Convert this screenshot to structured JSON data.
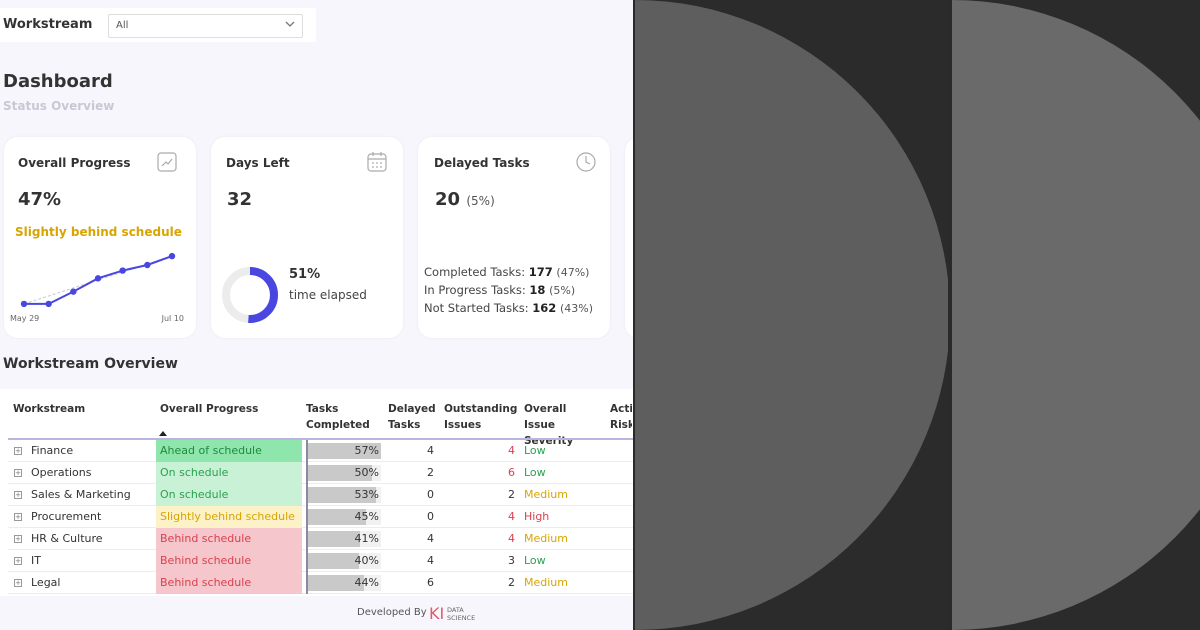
{
  "filter": {
    "label": "Workstream",
    "value": "All"
  },
  "header": {
    "title": "Dashboard",
    "subtitle": "Status Overview"
  },
  "cards": {
    "progress": {
      "title": "Overall Progress",
      "value": "47%",
      "status": "Slightly behind schedule",
      "start_label": "May 29",
      "end_label": "Jul 10",
      "icon": "trend-icon"
    },
    "days_left": {
      "title": "Days Left",
      "value": "32",
      "elapsed_pct": "51%",
      "elapsed_label": "time elapsed",
      "elapsed_fraction": 0.51,
      "icon": "calendar-icon"
    },
    "delayed": {
      "title": "Delayed Tasks",
      "value": "20",
      "value_pct": "(5%)",
      "icon": "clock-icon",
      "lines": [
        {
          "label": "Completed Tasks:",
          "count": "177",
          "pct": "(47%)"
        },
        {
          "label": "In Progress Tasks:",
          "count": "18",
          "pct": "(5%)"
        },
        {
          "label": "Not Started Tasks:",
          "count": "162",
          "pct": "(43%)"
        }
      ]
    }
  },
  "chart_data": {
    "type": "line",
    "x": [
      "May 29",
      "",
      "",
      "",
      "",
      "",
      "Jul 10"
    ],
    "series": [
      {
        "values": [
          1,
          1,
          12,
          24,
          31,
          36,
          44
        ]
      }
    ],
    "trend": [
      1,
      44
    ]
  },
  "table": {
    "title": "Workstream Overview",
    "headers": [
      "Workstream",
      "Overall Progress",
      "Tasks Completed",
      "Delayed Tasks",
      "Outstanding Issues",
      "Overall Issue Severity",
      "Acti Risk"
    ],
    "rows": [
      {
        "name": "Finance",
        "status": "Ahead of schedule",
        "completed": "57%",
        "completed_value": 0.57,
        "delayed": "4",
        "issues": "4",
        "severity": "Low"
      },
      {
        "name": "Operations",
        "status": "On schedule",
        "completed": "50%",
        "completed_value": 0.5,
        "delayed": "2",
        "issues": "6",
        "severity": "Low"
      },
      {
        "name": "Sales & Marketing",
        "status": "On schedule",
        "completed": "53%",
        "completed_value": 0.53,
        "delayed": "0",
        "issues": "2",
        "severity": "Medium"
      },
      {
        "name": "Procurement",
        "status": "Slightly behind schedule",
        "completed": "45%",
        "completed_value": 0.45,
        "delayed": "0",
        "issues": "4",
        "severity": "High"
      },
      {
        "name": "HR & Culture",
        "status": "Behind schedule",
        "completed": "41%",
        "completed_value": 0.41,
        "delayed": "4",
        "issues": "4",
        "severity": "Medium"
      },
      {
        "name": "IT",
        "status": "Behind schedule",
        "completed": "40%",
        "completed_value": 0.4,
        "delayed": "4",
        "issues": "3",
        "severity": "Low"
      },
      {
        "name": "Legal",
        "status": "Behind schedule",
        "completed": "44%",
        "completed_value": 0.44,
        "delayed": "6",
        "issues": "2",
        "severity": "Medium"
      }
    ]
  },
  "footer": {
    "text": "Developed By",
    "logo_mark": "KI",
    "logo_text_1": "DATA",
    "logo_text_2": "SCIENCE"
  },
  "colors": {
    "accent": "#4a46e0",
    "ahead": "#8fe6ad",
    "ahead_text": "#1f8a3c",
    "on": "#c9f1d6",
    "on_text": "#2aa24f",
    "slight": "#fdf1c7",
    "slight_text": "#d9a400",
    "behind": "#f5c6cb",
    "behind_text": "#d9414f",
    "sev_low": "#2aa24f",
    "sev_medium": "#d9a400",
    "sev_high": "#d9414f"
  }
}
